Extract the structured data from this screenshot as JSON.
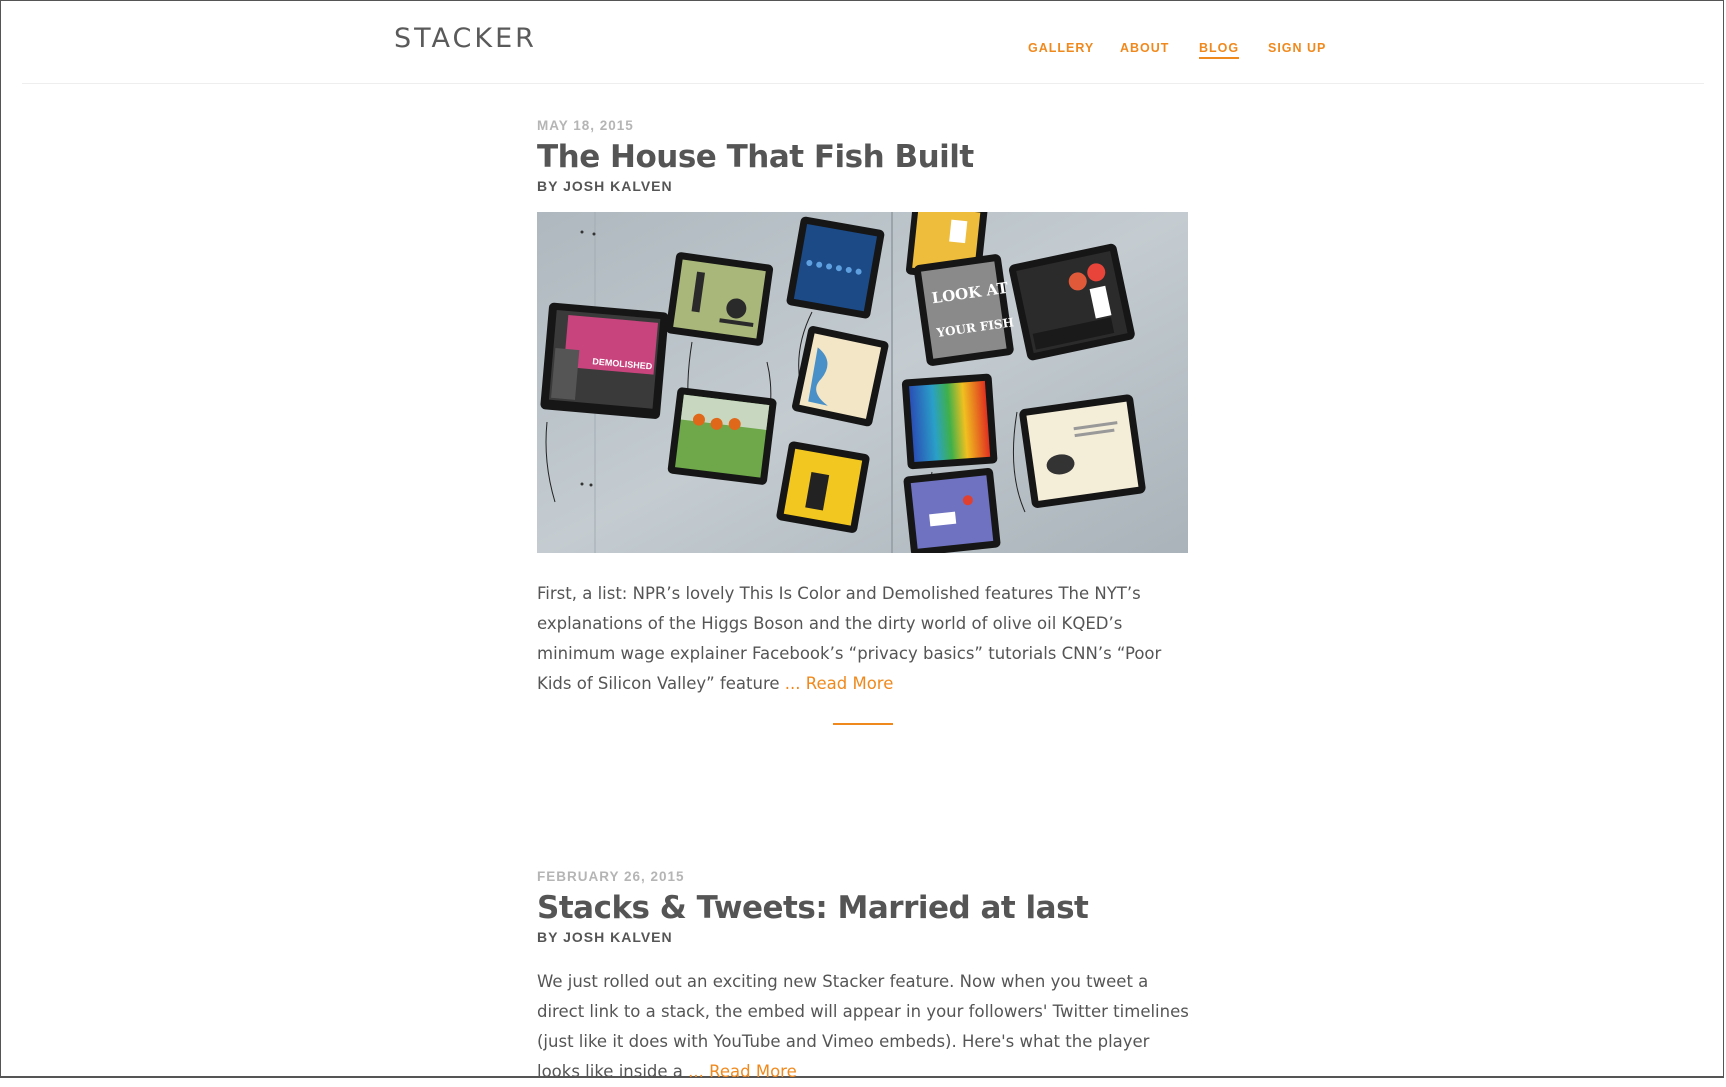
{
  "site": {
    "logo": "STACKER",
    "accent_color": "#f0891d"
  },
  "nav": {
    "items": [
      {
        "label": "GALLERY"
      },
      {
        "label": "ABOUT"
      },
      {
        "label": "BLOG",
        "active": true
      },
      {
        "label": "SIGN UP"
      }
    ]
  },
  "posts": [
    {
      "date": "MAY 18, 2015",
      "title": "The House That Fish Built",
      "author": "BY JOSH KALVEN",
      "image_text": {
        "demolished": "DEMOLISHED",
        "look_at": "LOOK AT",
        "your_fish": "YOUR FISH"
      },
      "excerpt": "First, a list: NPR’s lovely This Is Color and Demolished features The NYT’s explanations of the Higgs Boson and the dirty world of olive oil KQED’s minimum wage explainer Facebook’s “privacy basics” tutorials CNN’s “Poor Kids of Silicon Valley” feature",
      "read_more": "... Read More"
    },
    {
      "date": "FEBRUARY 26, 2015",
      "title": "Stacks & Tweets: Married at last",
      "author": "BY JOSH KALVEN",
      "excerpt": "We just rolled out an exciting new Stacker feature. Now when you tweet a direct link to a stack, the embed will appear in your followers' Twitter timelines (just like it does with YouTube and Vimeo embeds). Here's what the player looks like inside a",
      "read_more": "... Read More"
    }
  ]
}
